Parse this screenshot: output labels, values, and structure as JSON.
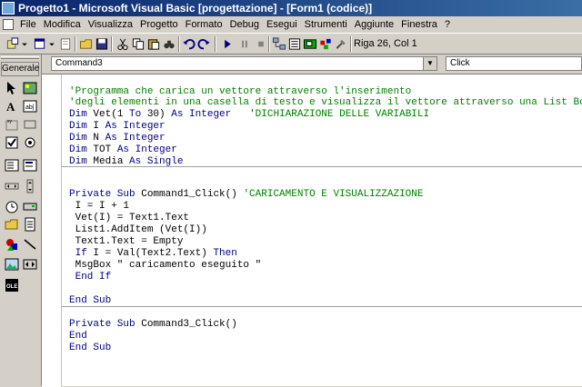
{
  "window": {
    "title": "Progetto1 - Microsoft Visual Basic [progettazione] - [Form1 (codice)]"
  },
  "menu": [
    "File",
    "Modifica",
    "Visualizza",
    "Progetto",
    "Formato",
    "Debug",
    "Esegui",
    "Strumenti",
    "Aggiunte",
    "Finestra",
    "?"
  ],
  "toolbar": {
    "position": "Riga 26, Col 1"
  },
  "toolbox": {
    "header": "Generale"
  },
  "editor": {
    "object_combo": "Command3",
    "proc_combo": "Click",
    "lines": [
      "'Programma che carica un vettore attraverso l'inserimento",
      "'degli elementi in una casella di testo e visualizza il vettore attraverso una List Box",
      "Dim Vet(1 To 30) As Integer   'DICHIARAZIONE DELLE VARIABILI",
      "Dim I As Integer",
      "Dim N As Integer",
      "Dim TOT As Integer",
      "Dim Media As Single",
      "Private Sub Command1_Click() 'CARICAMENTO E VISUALIZZAZIONE",
      " I = I + 1",
      " Vet(I) = Text1.Text",
      " List1.AddItem (Vet(I))",
      " Text1.Text = Empty",
      " If I = Val(Text2.Text) Then",
      " MsgBox \" caricamento eseguito \"",
      " End If",
      "End Sub",
      "Private Sub Command3_Click()",
      "End",
      "End Sub"
    ]
  },
  "colors": {
    "title_start": "#0a246a",
    "title_end": "#3a6ea5",
    "comment": "#008000",
    "keyword": "#000080"
  }
}
